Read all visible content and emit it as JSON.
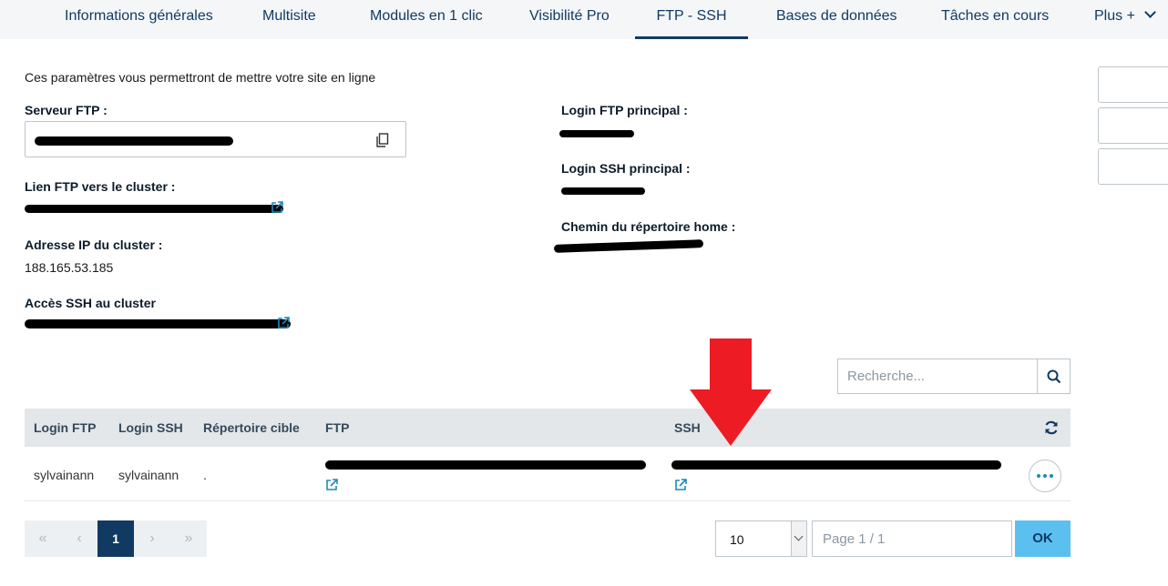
{
  "tabs": [
    {
      "label": "Informations générales",
      "active": false
    },
    {
      "label": "Multisite",
      "active": false
    },
    {
      "label": "Modules en 1 clic",
      "active": false
    },
    {
      "label": "Visibilité Pro",
      "active": false
    },
    {
      "label": "FTP - SSH",
      "active": true
    },
    {
      "label": "Bases de données",
      "active": false
    },
    {
      "label": "Tâches en cours",
      "active": false
    },
    {
      "label": "Plus +",
      "active": false
    }
  ],
  "intro": "Ces paramètres vous permettront de mettre votre site en ligne",
  "left": {
    "ftp_server_label": "Serveur FTP :",
    "ftp_link_label": "Lien FTP vers le cluster :",
    "ip_label": "Adresse IP du cluster :",
    "ip_value": "188.165.53.185",
    "ssh_access_label": "Accès SSH au cluster"
  },
  "right": {
    "ftp_login_label": "Login FTP principal :",
    "ssh_login_label": "Login SSH principal :",
    "home_label": "Chemin du répertoire home :"
  },
  "search": {
    "placeholder": "Recherche..."
  },
  "table": {
    "headers": [
      "Login FTP",
      "Login SSH",
      "Répertoire cible",
      "FTP",
      "SSH"
    ],
    "rows": [
      {
        "login_ftp": "sylvainann",
        "login_ssh": "sylvainann",
        "target_dir": "."
      }
    ]
  },
  "pagination": {
    "first": "«",
    "prev": "‹",
    "current": "1",
    "next": "›",
    "last": "»",
    "page_size": "10",
    "page_placeholder": "Page 1 / 1",
    "ok_label": "OK"
  },
  "colors": {
    "primary": "#113a63",
    "link": "#1d8ab8",
    "ok_button": "#5bc0f0",
    "annotation_arrow": "#ed1c24"
  }
}
